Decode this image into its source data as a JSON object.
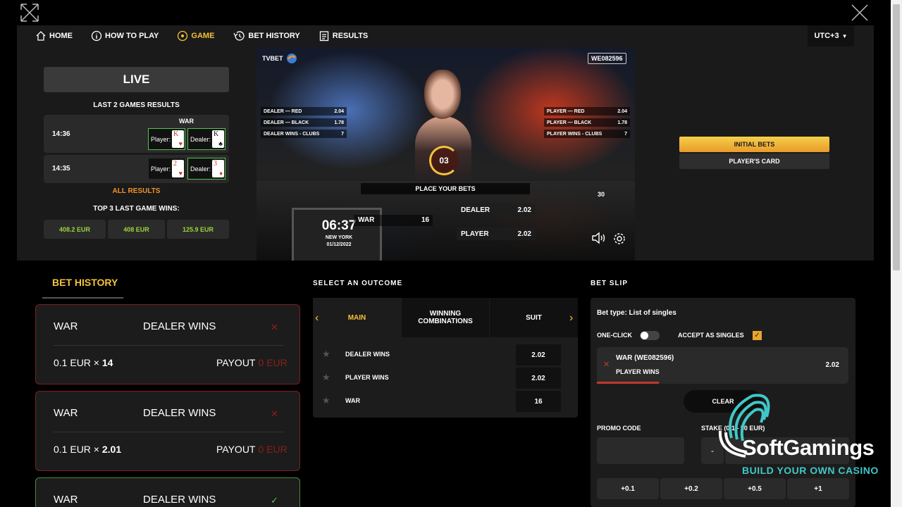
{
  "nav": {
    "items": [
      {
        "label": "HOME",
        "icon": "home-icon"
      },
      {
        "label": "HOW TO PLAY",
        "icon": "info-icon"
      },
      {
        "label": "GAME",
        "icon": "game-icon"
      },
      {
        "label": "BET HISTORY",
        "icon": "history-icon"
      },
      {
        "label": "RESULTS",
        "icon": "results-icon"
      }
    ],
    "timezone": "UTC+3"
  },
  "left": {
    "live": "LIVE",
    "last_results_title": "LAST 2 GAMES RESULTS",
    "game_name": "WAR",
    "results": [
      {
        "time": "14:36",
        "player_label": "Player:",
        "player_rank": "K",
        "player_suit": "♥",
        "dealer_label": "Dealer:",
        "dealer_rank": "K",
        "dealer_suit": "♣"
      },
      {
        "time": "14:35",
        "player_label": "Player:",
        "player_rank": "2",
        "player_suit": "♥",
        "dealer_label": "Dealer:",
        "dealer_rank": "3",
        "dealer_suit": "♦"
      }
    ],
    "all_results": "ALL RESULTS",
    "top_wins_title": "TOP 3 LAST GAME WINS:",
    "top_wins": [
      "408.2 EUR",
      "408 EUR",
      "125.9 EUR"
    ]
  },
  "video": {
    "brand": "TVBET",
    "game_id": "WE082596",
    "left_odds": [
      {
        "label": "DEALER — RED",
        "value": "2.04"
      },
      {
        "label": "DEALER — BLACK",
        "value": "1.78"
      },
      {
        "label": "DEALER WINS - CLUBS",
        "value": "7"
      }
    ],
    "right_odds": [
      {
        "label": "PLAYER — RED",
        "value": "2.04"
      },
      {
        "label": "PLAYER — BLACK",
        "value": "1.78"
      },
      {
        "label": "PLAYER WINS - CLUBS",
        "value": "7"
      }
    ],
    "timer": "03",
    "place_bets": "PLACE YOUR BETS",
    "side_number": "30",
    "clock_time": "06:37",
    "clock_city": "NEW YORK",
    "clock_date": "01/12/2022",
    "war_label": "WAR",
    "war_value": "16",
    "dealer_label": "DEALER",
    "dealer_value": "2.02",
    "player_label": "PLAYER",
    "player_value": "2.02"
  },
  "right_top": {
    "initial_bets": "INITIAL BETS",
    "players_card": "PLAYER'S CARD"
  },
  "bet_history": {
    "tab": "BET HISTORY",
    "cards": [
      {
        "game": "WAR",
        "outcome": "DEALER WINS",
        "status_icon": "✕",
        "stake": "0.1 EUR ×",
        "odds": "14",
        "payout_label": "PAYOUT",
        "payout_value": "0 EUR",
        "won": false
      },
      {
        "game": "WAR",
        "outcome": "DEALER WINS",
        "status_icon": "✕",
        "stake": "0.1 EUR ×",
        "odds": "2.01",
        "payout_label": "PAYOUT",
        "payout_value": "0 EUR",
        "won": false
      },
      {
        "game": "WAR",
        "outcome": "DEALER WINS",
        "status_icon": "✓",
        "won": true
      }
    ]
  },
  "outcome": {
    "title": "SELECT AN OUTCOME",
    "tabs": [
      "MAIN",
      "WINNING COMBINATIONS",
      "SUIT"
    ],
    "rows": [
      {
        "name": "DEALER WINS",
        "odd": "2.02"
      },
      {
        "name": "PLAYER WINS",
        "odd": "2.02"
      },
      {
        "name": "WAR",
        "odd": "16"
      }
    ]
  },
  "bet_slip": {
    "title": "BET SLIP",
    "bet_type": "Bet type:  List of singles",
    "one_click": "ONE-CLICK",
    "accept_singles": "ACCEPT AS SINGLES",
    "item_title": "WAR (WE082596)",
    "item_outcome": "PLAYER WINS",
    "item_odd": "2.02",
    "clear": "CLEAR",
    "promo_label": "PROMO CODE",
    "stake_label": "STAKE (0.1 - 50 EUR)",
    "minus": "-",
    "chips": [
      "+0.1",
      "+0.2",
      "+0.5",
      "+1"
    ]
  },
  "watermark": {
    "brand": "SoftGamings",
    "tagline": "BUILD YOUR OWN CASINO"
  }
}
